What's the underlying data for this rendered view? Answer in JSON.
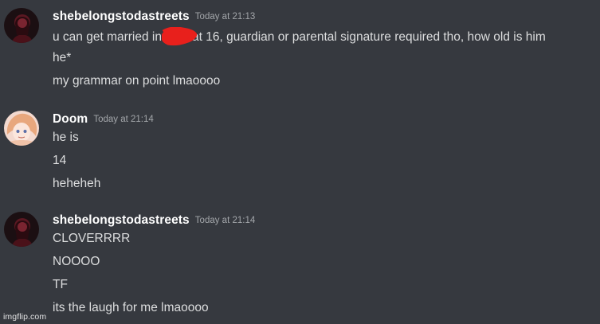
{
  "messages": [
    {
      "username": "shebelongstodastreets",
      "timestamp": "Today at 21:13",
      "lines": {
        "l1_before": "u can get married in",
        "l1_after": "at 16, guardian or parental signature required tho, how old is him",
        "l2": "he*",
        "l3": "my grammar on point lmaoooo"
      }
    },
    {
      "username": "Doom",
      "timestamp": "Today at 21:14",
      "lines": {
        "l1": "he is",
        "l2": "14",
        "l3": "heheheh"
      }
    },
    {
      "username": "shebelongstodastreets",
      "timestamp": "Today at 21:14",
      "lines": {
        "l1": "CLOVERRRR",
        "l2": "NOOOO",
        "l3": "TF",
        "l4": "its the laugh for me lmaoooo"
      }
    }
  ],
  "watermark": "imgflip.com",
  "colors": {
    "background": "#36393f",
    "username": "#ffffff",
    "message_text": "#dcddde",
    "timestamp": "#a3a6aa",
    "redaction": "#e8201c"
  }
}
